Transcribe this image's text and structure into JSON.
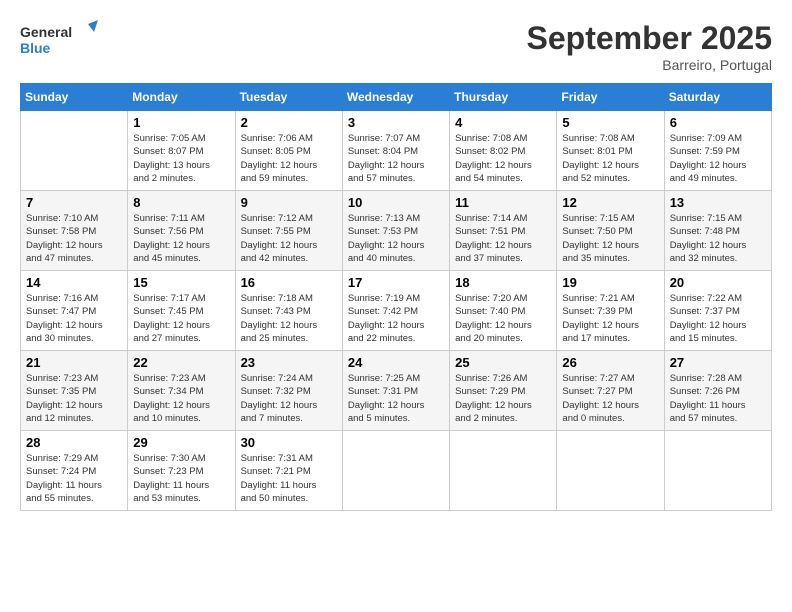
{
  "header": {
    "logo_line1": "General",
    "logo_line2": "Blue",
    "month_title": "September 2025",
    "location": "Barreiro, Portugal"
  },
  "days_of_week": [
    "Sunday",
    "Monday",
    "Tuesday",
    "Wednesday",
    "Thursday",
    "Friday",
    "Saturday"
  ],
  "weeks": [
    [
      {
        "day": "",
        "info": ""
      },
      {
        "day": "1",
        "info": "Sunrise: 7:05 AM\nSunset: 8:07 PM\nDaylight: 13 hours\nand 2 minutes."
      },
      {
        "day": "2",
        "info": "Sunrise: 7:06 AM\nSunset: 8:05 PM\nDaylight: 12 hours\nand 59 minutes."
      },
      {
        "day": "3",
        "info": "Sunrise: 7:07 AM\nSunset: 8:04 PM\nDaylight: 12 hours\nand 57 minutes."
      },
      {
        "day": "4",
        "info": "Sunrise: 7:08 AM\nSunset: 8:02 PM\nDaylight: 12 hours\nand 54 minutes."
      },
      {
        "day": "5",
        "info": "Sunrise: 7:08 AM\nSunset: 8:01 PM\nDaylight: 12 hours\nand 52 minutes."
      },
      {
        "day": "6",
        "info": "Sunrise: 7:09 AM\nSunset: 7:59 PM\nDaylight: 12 hours\nand 49 minutes."
      }
    ],
    [
      {
        "day": "7",
        "info": "Sunrise: 7:10 AM\nSunset: 7:58 PM\nDaylight: 12 hours\nand 47 minutes."
      },
      {
        "day": "8",
        "info": "Sunrise: 7:11 AM\nSunset: 7:56 PM\nDaylight: 12 hours\nand 45 minutes."
      },
      {
        "day": "9",
        "info": "Sunrise: 7:12 AM\nSunset: 7:55 PM\nDaylight: 12 hours\nand 42 minutes."
      },
      {
        "day": "10",
        "info": "Sunrise: 7:13 AM\nSunset: 7:53 PM\nDaylight: 12 hours\nand 40 minutes."
      },
      {
        "day": "11",
        "info": "Sunrise: 7:14 AM\nSunset: 7:51 PM\nDaylight: 12 hours\nand 37 minutes."
      },
      {
        "day": "12",
        "info": "Sunrise: 7:15 AM\nSunset: 7:50 PM\nDaylight: 12 hours\nand 35 minutes."
      },
      {
        "day": "13",
        "info": "Sunrise: 7:15 AM\nSunset: 7:48 PM\nDaylight: 12 hours\nand 32 minutes."
      }
    ],
    [
      {
        "day": "14",
        "info": "Sunrise: 7:16 AM\nSunset: 7:47 PM\nDaylight: 12 hours\nand 30 minutes."
      },
      {
        "day": "15",
        "info": "Sunrise: 7:17 AM\nSunset: 7:45 PM\nDaylight: 12 hours\nand 27 minutes."
      },
      {
        "day": "16",
        "info": "Sunrise: 7:18 AM\nSunset: 7:43 PM\nDaylight: 12 hours\nand 25 minutes."
      },
      {
        "day": "17",
        "info": "Sunrise: 7:19 AM\nSunset: 7:42 PM\nDaylight: 12 hours\nand 22 minutes."
      },
      {
        "day": "18",
        "info": "Sunrise: 7:20 AM\nSunset: 7:40 PM\nDaylight: 12 hours\nand 20 minutes."
      },
      {
        "day": "19",
        "info": "Sunrise: 7:21 AM\nSunset: 7:39 PM\nDaylight: 12 hours\nand 17 minutes."
      },
      {
        "day": "20",
        "info": "Sunrise: 7:22 AM\nSunset: 7:37 PM\nDaylight: 12 hours\nand 15 minutes."
      }
    ],
    [
      {
        "day": "21",
        "info": "Sunrise: 7:23 AM\nSunset: 7:35 PM\nDaylight: 12 hours\nand 12 minutes."
      },
      {
        "day": "22",
        "info": "Sunrise: 7:23 AM\nSunset: 7:34 PM\nDaylight: 12 hours\nand 10 minutes."
      },
      {
        "day": "23",
        "info": "Sunrise: 7:24 AM\nSunset: 7:32 PM\nDaylight: 12 hours\nand 7 minutes."
      },
      {
        "day": "24",
        "info": "Sunrise: 7:25 AM\nSunset: 7:31 PM\nDaylight: 12 hours\nand 5 minutes."
      },
      {
        "day": "25",
        "info": "Sunrise: 7:26 AM\nSunset: 7:29 PM\nDaylight: 12 hours\nand 2 minutes."
      },
      {
        "day": "26",
        "info": "Sunrise: 7:27 AM\nSunset: 7:27 PM\nDaylight: 12 hours\nand 0 minutes."
      },
      {
        "day": "27",
        "info": "Sunrise: 7:28 AM\nSunset: 7:26 PM\nDaylight: 11 hours\nand 57 minutes."
      }
    ],
    [
      {
        "day": "28",
        "info": "Sunrise: 7:29 AM\nSunset: 7:24 PM\nDaylight: 11 hours\nand 55 minutes."
      },
      {
        "day": "29",
        "info": "Sunrise: 7:30 AM\nSunset: 7:23 PM\nDaylight: 11 hours\nand 53 minutes."
      },
      {
        "day": "30",
        "info": "Sunrise: 7:31 AM\nSunset: 7:21 PM\nDaylight: 11 hours\nand 50 minutes."
      },
      {
        "day": "",
        "info": ""
      },
      {
        "day": "",
        "info": ""
      },
      {
        "day": "",
        "info": ""
      },
      {
        "day": "",
        "info": ""
      }
    ]
  ]
}
